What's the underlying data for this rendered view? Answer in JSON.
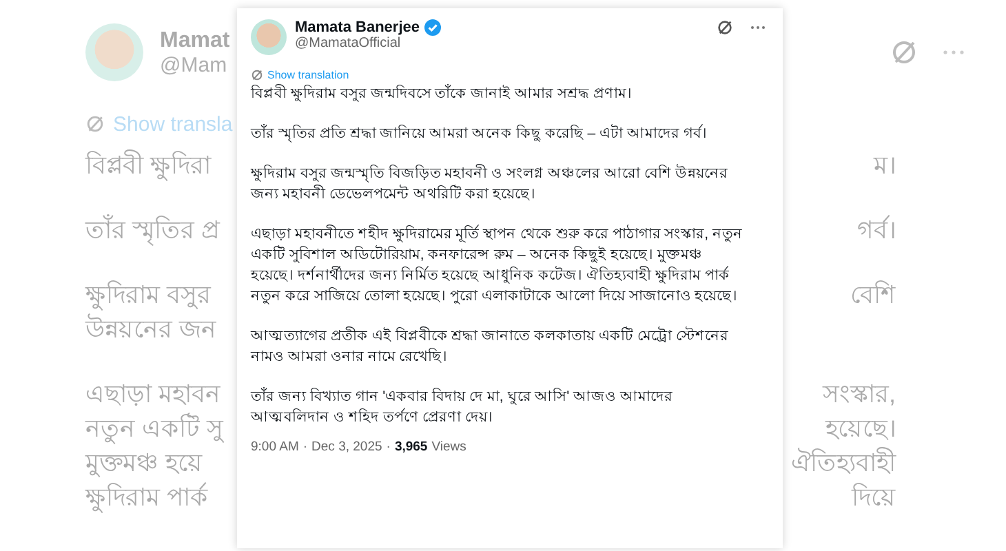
{
  "background_tweet": {
    "author_name": "Mamat",
    "handle": "@Mam",
    "show_translation": "Show transla",
    "paragraphs": [
      [
        {
          "left": "বিপ্লবী ক্ষুদিরা",
          "right": "ম।"
        }
      ],
      [
        {
          "left": "তাঁর স্মৃতির প্র",
          "right": "গর্ব।"
        }
      ],
      [
        {
          "left": "ক্ষুদিরাম বসুর",
          "right": "বেশি"
        },
        {
          "left": "উন্নয়নের জন"
        }
      ],
      [
        {
          "left": "এছাড়া মহাবন",
          "right": "সংস্কার,"
        },
        {
          "left": "নতুন একটি সু",
          "right": "হয়েছে।"
        },
        {
          "left": "মুক্তমঞ্চ হয়ে",
          "right": "ঐতিহ্যবাহী"
        },
        {
          "left": "ক্ষুদিরাম পার্ক",
          "right": "দিয়ে"
        }
      ]
    ]
  },
  "tweet": {
    "author_name": "Mamata Banerjee",
    "verified": true,
    "handle": "@MamataOfficial",
    "show_translation": "Show translation",
    "paragraphs": [
      "বিপ্লবী ক্ষুদিরাম বসুর জন্মদিবসে তাঁকে জানাই আমার সশ্রদ্ধ প্রণাম।",
      "তাঁর স্মৃতির প্রতি শ্রদ্ধা জানিয়ে আমরা অনেক কিছু করেছি – এটা আমাদের গর্ব।",
      "ক্ষুদিরাম বসুর জন্মস্মৃতি বিজড়িত মহাবনী ও সংলগ্ন অঞ্চলের আরো বেশি উন্নয়নের জন্য মহাবনী ডেভেলপমেন্ট অথরিটি করা হয়েছে।",
      "এছাড়া মহাবনীতে শহীদ ক্ষুদিরামের মূর্তি স্থাপন থেকে শুরু করে পাঠাগার সংস্কার, নতুন একটি সুবিশাল অডিটোরিয়াম, কনফারেন্স রুম – অনেক কিছুই হয়েছে। মুক্তমঞ্চ হয়েছে। দর্শনার্থীদের জন্য নির্মিত হয়েছে আধুনিক কটেজ। ঐতিহ্যবাহী ক্ষুদিরাম পার্ক নতুন করে সাজিয়ে তোলা হয়েছে।  পুরো এলাকাটাকে আলো দিয়ে সাজানোও হয়েছে।",
      "আত্মত্যাগের প্রতীক এই বিপ্লবীকে শ্রদ্ধা জানাতে কলকাতায় একটি মেট্রো স্টেশনের নামও আমরা ওনার নামে রেখেছি।",
      "তাঁর জন্য বিখ্যাত গান 'একবার বিদায় দে মা, ঘুরে আসি' আজও আমাদের আত্মবলিদান ও শহিদ তর্পণে প্রেরণা দেয়।"
    ],
    "time": "9:00 AM",
    "date": "Dec 3, 2025",
    "separator": "·",
    "views_count": "3,965",
    "views_label": "Views"
  }
}
